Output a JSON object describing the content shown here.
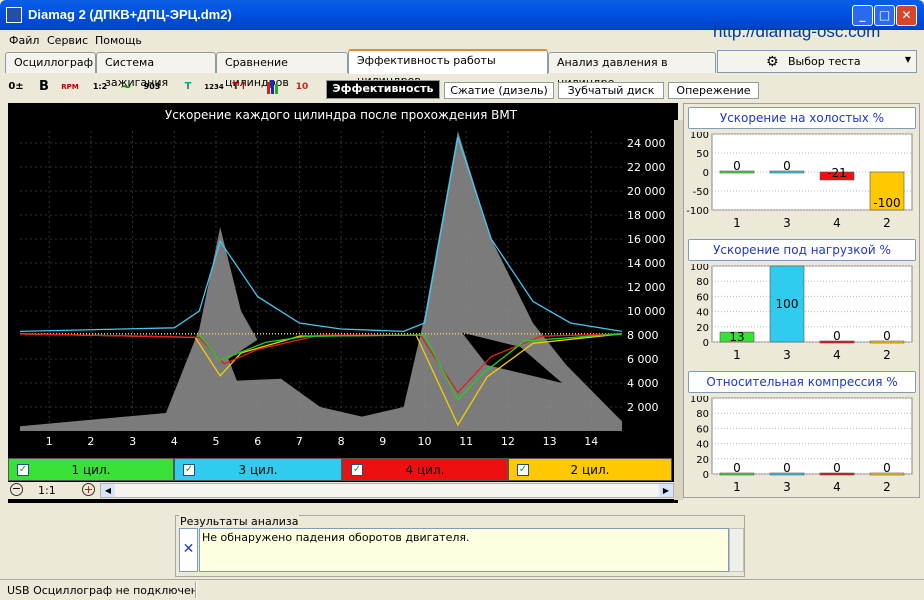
{
  "window": {
    "title": "Diamag 2 (ДПКВ+ДПЦ-ЭРЦ.dm2)",
    "url": "http://diamag-osc.com"
  },
  "menu": [
    "Файл",
    "Сервис",
    "Помощь"
  ],
  "main_tabs": [
    {
      "label": "Осциллограф"
    },
    {
      "label": "Система зажигания"
    },
    {
      "label": "Сравнение цилиндров"
    },
    {
      "label": "Эффективность работы цилиндров",
      "active": true
    },
    {
      "label": "Анализ давления в цилиндре"
    }
  ],
  "test_select": {
    "label": "Выбор теста"
  },
  "toolbar": [
    "0±",
    "B",
    "RPM",
    "1:2",
    "~",
    "903",
    "T",
    "1234",
    "T↑",
    "bars",
    "10"
  ],
  "sub_tabs": [
    {
      "label": "Эффективность",
      "active": true
    },
    {
      "label": "Сжатие (дизель)"
    },
    {
      "label": "Зубчатый диск"
    },
    {
      "label": "Опережение"
    }
  ],
  "main_chart": {
    "title": "Ускорение каждого цилиндра после прохождения ВМТ",
    "x_ticks": [
      "1",
      "2",
      "3",
      "4",
      "5",
      "6",
      "7",
      "8",
      "9",
      "10",
      "11",
      "12",
      "13",
      "14"
    ],
    "y_ticks": [
      "2 000",
      "4 000",
      "6 000",
      "8 000",
      "10 000",
      "12 000",
      "14 000",
      "16 000",
      "18 000",
      "20 000",
      "22 000",
      "24 000"
    ],
    "colors": {
      "gray": "#909090",
      "cyan": "#44c8f0",
      "green": "#20d020",
      "red": "#e02020",
      "yellow": "#f0d000",
      "baseline": "#e8c86c"
    }
  },
  "channels": [
    {
      "label": "1 цил.",
      "color": "#38e038",
      "checked": true
    },
    {
      "label": "3 цил.",
      "color": "#30ccf0",
      "checked": true
    },
    {
      "label": "4 цил.",
      "color": "#ee1010",
      "checked": true
    },
    {
      "label": "2 цил.",
      "color": "#ffc800",
      "checked": true
    }
  ],
  "zoom": {
    "value": "1:1"
  },
  "chart_data": [
    {
      "type": "bar",
      "title": "Ускорение на холостых %",
      "categories": [
        "1",
        "3",
        "4",
        "2"
      ],
      "values": [
        0,
        0,
        -21,
        -100
      ],
      "ylim": [
        -100,
        100
      ],
      "yticks": [
        "100",
        "50",
        "0",
        "-50",
        "-100"
      ],
      "colors": [
        "#38e038",
        "#30ccf0",
        "#ee1010",
        "#ffc800"
      ]
    },
    {
      "type": "bar",
      "title": "Ускорение под нагрузкой %",
      "categories": [
        "1",
        "3",
        "4",
        "2"
      ],
      "values": [
        13,
        100,
        0,
        0
      ],
      "ylim": [
        0,
        100
      ],
      "yticks": [
        "100",
        "80",
        "60",
        "40",
        "20",
        "0"
      ],
      "colors": [
        "#38e038",
        "#30ccf0",
        "#ee1010",
        "#ffc800"
      ]
    },
    {
      "type": "bar",
      "title": "Относительная компрессия %",
      "categories": [
        "1",
        "3",
        "4",
        "2"
      ],
      "values": [
        0,
        0,
        0,
        0
      ],
      "ylim": [
        0,
        100
      ],
      "yticks": [
        "100",
        "80",
        "60",
        "40",
        "20",
        "0"
      ],
      "colors": [
        "#38e038",
        "#30ccf0",
        "#ee1010",
        "#ffc800"
      ]
    }
  ],
  "results": {
    "title": "Результаты анализа",
    "text": "Не обнаружено падения оборотов двигателя."
  },
  "status": {
    "text": "USB Осциллограф не подключен"
  }
}
